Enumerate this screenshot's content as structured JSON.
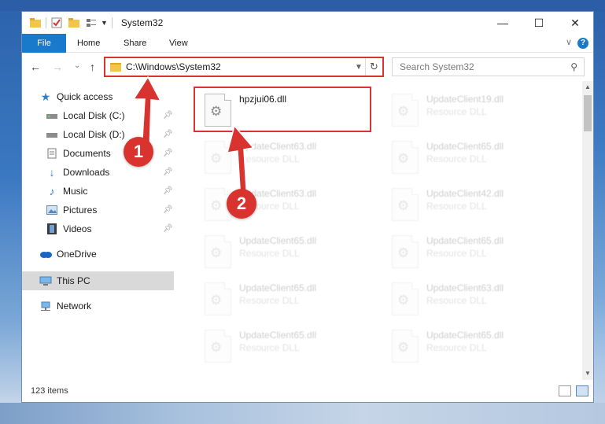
{
  "window": {
    "title": "System32"
  },
  "ribbon": {
    "tabs": [
      "File",
      "Home",
      "Share",
      "View"
    ],
    "help_glyph": "?"
  },
  "nav": {
    "back_glyph": "←",
    "forward_glyph": "→",
    "recent_glyph": "⌄",
    "up_glyph": "↑",
    "address": "C:\\Windows\\System32",
    "search_placeholder": "Search System32"
  },
  "sidebar": {
    "items": [
      {
        "label": "Quick access",
        "icon": "star-icon"
      },
      {
        "label": "Local Disk (C:)",
        "icon": "drive-icon",
        "pinned": true
      },
      {
        "label": "Local Disk (D:)",
        "icon": "drive-icon",
        "pinned": true
      },
      {
        "label": "Documents",
        "icon": "documents-icon",
        "pinned": true
      },
      {
        "label": "Downloads",
        "icon": "download-icon",
        "pinned": true
      },
      {
        "label": "Music",
        "icon": "music-icon",
        "pinned": true
      },
      {
        "label": "Pictures",
        "icon": "pictures-icon",
        "pinned": true
      },
      {
        "label": "Videos",
        "icon": "videos-icon",
        "pinned": true
      },
      {
        "label": "OneDrive",
        "icon": "cloud-icon"
      },
      {
        "label": "This PC",
        "icon": "computer-icon",
        "selected": true
      },
      {
        "label": "Network",
        "icon": "network-icon"
      }
    ]
  },
  "files": {
    "left": [
      {
        "name": "hpzjui06.dll",
        "type": ""
      },
      {
        "name": "UpdateClient63.dll",
        "type": "Resource DLL"
      },
      {
        "name": "UpdateClient63.dll",
        "type": "Resource DLL"
      },
      {
        "name": "UpdateClient65.dll",
        "type": "Resource DLL"
      },
      {
        "name": "UpdateClient65.dll",
        "type": "Resource DLL"
      },
      {
        "name": "UpdateClient65.dll",
        "type": "Resource DLL"
      }
    ],
    "right": [
      {
        "name": "UpdateClient19.dll",
        "type": "Resource DLL"
      },
      {
        "name": "UpdateClient65.dll",
        "type": "Resource DLL"
      },
      {
        "name": "UpdateClient42.dll",
        "type": "Resource DLL"
      },
      {
        "name": "UpdateClient65.dll",
        "type": "Resource DLL"
      },
      {
        "name": "UpdateClient63.dll",
        "type": "Resource DLL"
      },
      {
        "name": "UpdateClient65.dll",
        "type": "Resource DLL"
      }
    ]
  },
  "status": {
    "count": "123 items"
  },
  "annotations": {
    "step1": "1",
    "step2": "2",
    "color": "#d9332f"
  }
}
